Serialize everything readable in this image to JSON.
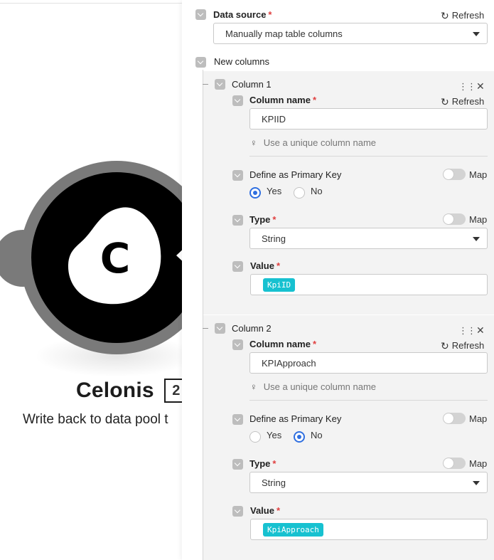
{
  "module": {
    "letter": "C",
    "name": "Celonis",
    "badge": "2",
    "subtitle": "Write back to data pool t"
  },
  "panel": {
    "data_source": {
      "label": "Data source",
      "required_mark": "*",
      "refresh_label": "Refresh",
      "selected": "Manually map table columns"
    },
    "new_columns": {
      "label": "New columns"
    },
    "columns": [
      {
        "title": "Column 1",
        "name_label": "Column name",
        "required_mark": "*",
        "refresh_label": "Refresh",
        "name_value": "KPIID",
        "hint": "Use a unique column name",
        "pk_label": "Define as Primary Key",
        "map_label": "Map",
        "yes_label": "Yes",
        "no_label": "No",
        "pk_selected": "Yes",
        "type_label": "Type",
        "type_value": "String",
        "value_label": "Value",
        "value_token": "KpiID"
      },
      {
        "title": "Column 2",
        "name_label": "Column name",
        "required_mark": "*",
        "refresh_label": "Refresh",
        "name_value": "KPIApproach",
        "hint": "Use a unique column name",
        "pk_label": "Define as Primary Key",
        "map_label": "Map",
        "yes_label": "Yes",
        "no_label": "No",
        "pk_selected": "No",
        "type_label": "Type",
        "type_value": "String",
        "value_label": "Value",
        "value_token": "KpiApproach"
      }
    ]
  },
  "colors": {
    "accent_blue": "#2f6fe0",
    "token_teal": "#17c1d0",
    "required_red": "#e04040",
    "module_dark": "#000000",
    "module_ring": "#7a7a7a"
  }
}
